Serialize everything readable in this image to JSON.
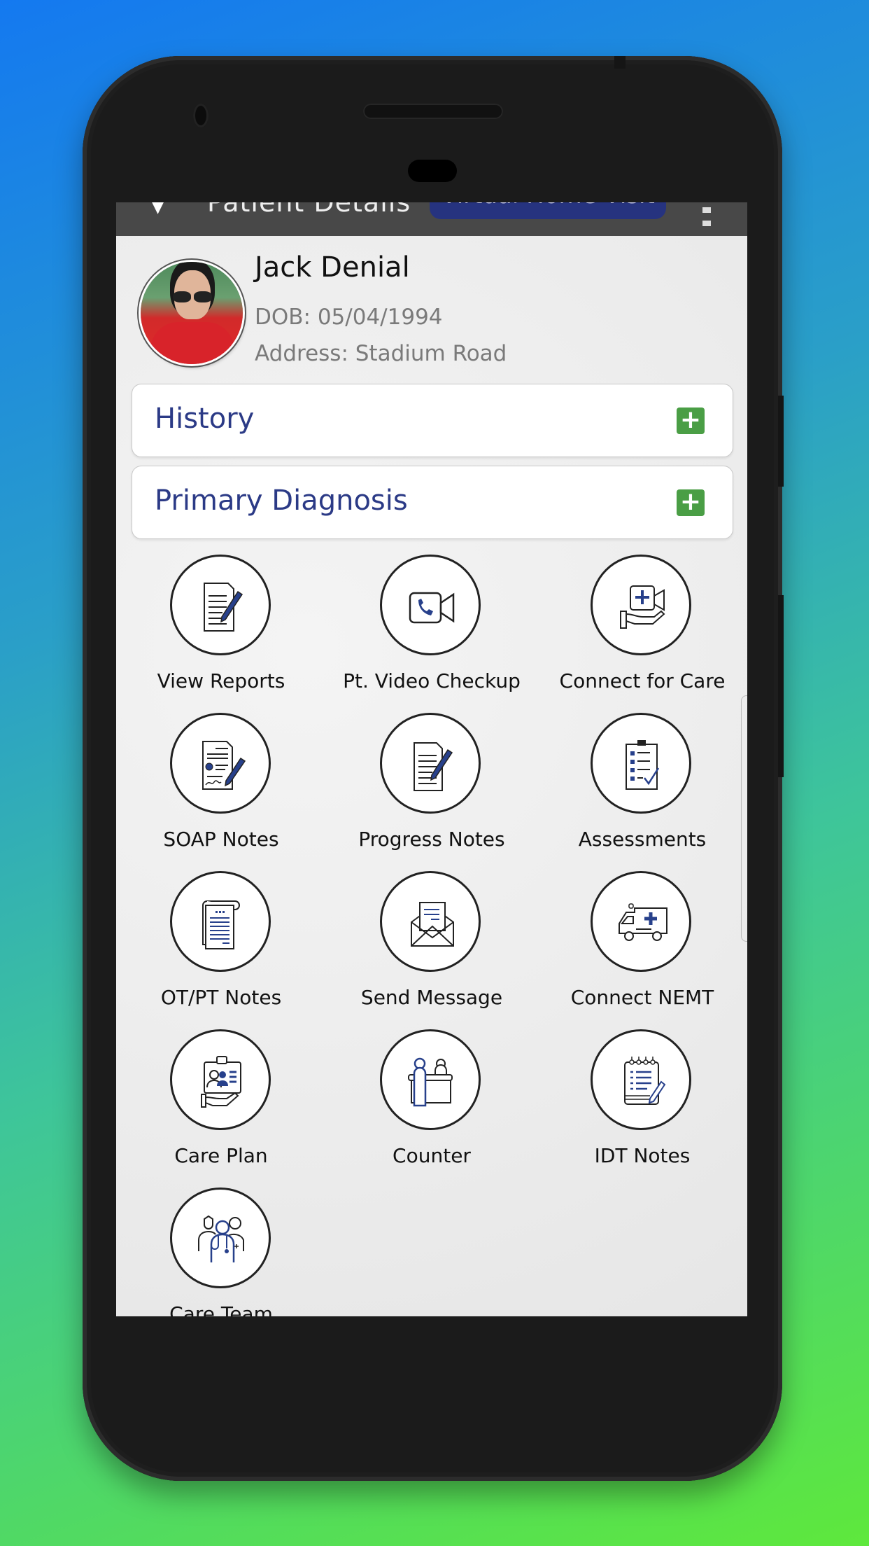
{
  "app_bar": {
    "back_icon": "arrow-left-icon",
    "title": "Patient Details",
    "action_button": "Virtual Home Visit",
    "menu_icon": "overflow-menu-icon"
  },
  "patient": {
    "name": "Jack Denial",
    "dob": "DOB: 05/04/1994",
    "address": "Address: Stadium Road"
  },
  "sections": [
    {
      "title": "History",
      "action_icon": "plus-icon"
    },
    {
      "title": "Primary Diagnosis",
      "action_icon": "plus-icon"
    }
  ],
  "tiles": [
    {
      "label": "View Reports",
      "icon": "document-edit-icon"
    },
    {
      "label": "Pt. Video Checkup",
      "icon": "video-call-icon"
    },
    {
      "label": "Connect for Care",
      "icon": "care-hand-icon"
    },
    {
      "label": "SOAP Notes",
      "icon": "signed-document-icon"
    },
    {
      "label": "Progress Notes",
      "icon": "document-pen-icon"
    },
    {
      "label": "Assessments",
      "icon": "clipboard-check-icon"
    },
    {
      "label": "OT/PT Notes",
      "icon": "scroll-notes-icon"
    },
    {
      "label": "Send Message",
      "icon": "envelope-letter-icon"
    },
    {
      "label": "Connect NEMT",
      "icon": "ambulance-icon"
    },
    {
      "label": "Care Plan",
      "icon": "care-plan-icon"
    },
    {
      "label": "Counter",
      "icon": "reception-counter-icon"
    },
    {
      "label": "IDT Notes",
      "icon": "notepad-pencil-icon"
    },
    {
      "label": "Care Team",
      "icon": "medical-team-icon"
    }
  ],
  "colors": {
    "accent_blue": "#2b3a86",
    "plus_green": "#4a9e45",
    "icon_blue": "#27408b"
  }
}
